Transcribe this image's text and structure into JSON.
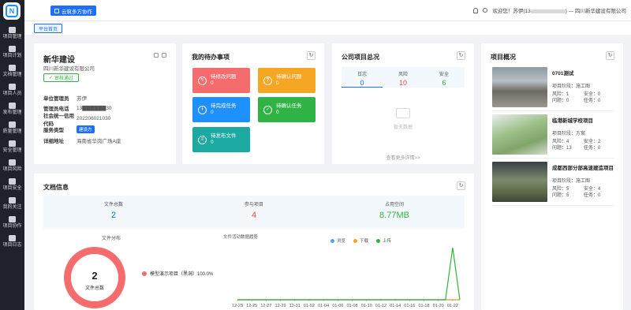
{
  "sidebar": {
    "items": [
      {
        "label": "项目管理",
        "icon": "folder-icon"
      },
      {
        "label": "项目计划",
        "icon": "calendar-icon"
      },
      {
        "label": "文档管理",
        "icon": "document-icon"
      },
      {
        "label": "项目人员",
        "icon": "user-icon"
      },
      {
        "label": "发布管理",
        "icon": "send-icon"
      },
      {
        "label": "质量管理",
        "icon": "check-icon"
      },
      {
        "label": "安全管理",
        "icon": "shield-icon"
      },
      {
        "label": "项目风险",
        "icon": "alert-icon"
      },
      {
        "label": "项目安全",
        "icon": "lock-icon"
      },
      {
        "label": "我的关注",
        "icon": "heart-icon"
      },
      {
        "label": "项目协作",
        "icon": "share-icon"
      },
      {
        "label": "项目日志",
        "icon": "list-icon"
      }
    ]
  },
  "header": {
    "collab_label": "云筑多方协作",
    "welcome": "欢迎您！苏伊(13",
    "company_suffix": ") — 四川新华建设有限公司"
  },
  "tabs": [
    {
      "label": "平台首页"
    }
  ],
  "company": {
    "name": "新华建设",
    "full_name": "四川新华建设有限公司",
    "audit_status": "审核通过",
    "fields": [
      {
        "key": "单位管理员",
        "value": "苏伊"
      },
      {
        "key": "管理员电话",
        "value": "13▇▇▇▇▇▇30"
      },
      {
        "key": "社会统一信用代码",
        "value": "202206021030"
      },
      {
        "key": "服务类型",
        "value": "建设方",
        "tag": true
      },
      {
        "key": "详细地址",
        "value": "海南省华岗广场A座"
      }
    ]
  },
  "todos": {
    "title": "我的待办事项",
    "items": [
      {
        "label": "待修改问题",
        "value": "0",
        "color": "#f56c6c",
        "icon": "edit-icon"
      },
      {
        "label": "待确认问题",
        "value": "0",
        "color": "#f5a623",
        "icon": "question-icon"
      },
      {
        "label": "待完成任务",
        "value": "0",
        "color": "#1e90ff",
        "icon": "info-icon"
      },
      {
        "label": "待确认任务",
        "value": "0",
        "color": "#2fb344",
        "icon": "check-icon"
      },
      {
        "label": "待发布文件",
        "value": "0",
        "color": "#1ba9a1",
        "icon": "file-icon"
      }
    ]
  },
  "overview": {
    "title": "公司项目总况",
    "cols": [
      {
        "label": "日志",
        "value": "0",
        "color": "#1e6fff"
      },
      {
        "label": "风险",
        "value": "10",
        "color": "#f04a4a"
      },
      {
        "label": "安全",
        "value": "6",
        "color": "#2fb344"
      }
    ],
    "empty_text": "暂无数据",
    "more_text": "查看更多详情>>"
  },
  "projects": {
    "title": "项目概况",
    "items": [
      {
        "name": "0701测试",
        "stage": "项目阶段：施工图",
        "risk": "风险：1",
        "safety": "安全：0",
        "issue": "问题：0",
        "task": "任务：0"
      },
      {
        "name": "临港新城学校项目",
        "stage": "项目阶段：方案",
        "risk": "风险：4",
        "safety": "安全：2",
        "issue": "问题：13",
        "task": "任务：0"
      },
      {
        "name": "成都西部分部高速建造项目",
        "stage": "项目阶段：施工图",
        "risk": "风险：5",
        "safety": "安全：4",
        "issue": "问题：5",
        "task": "任务：0"
      }
    ]
  },
  "docs": {
    "title": "文档信息",
    "stats": [
      {
        "label": "文件总数",
        "value": "2",
        "color": "#1e6fff"
      },
      {
        "label": "参与项目",
        "value": "4",
        "color": "#f04a4a"
      },
      {
        "label": "占用空间",
        "value": "8.77MB",
        "color": "#2fb344"
      }
    ],
    "dist_title": "文件分布",
    "donut_value": "2",
    "donut_label": "文件总数",
    "legend_label": "模型演示项目（黑洞）100.0%",
    "trend_title": "文件活动数据趋势"
  },
  "chart_data": {
    "type": "line",
    "title": "文件活动数据趋势",
    "categories": [
      "12-23",
      "12-25",
      "12-27",
      "12-29",
      "12-31",
      "01-02",
      "01-04",
      "01-06",
      "01-08",
      "01-10",
      "01-12",
      "01-14",
      "01-16",
      "01-18",
      "01-20",
      "01-22"
    ],
    "x": [
      "12-23",
      "12-24",
      "12-25",
      "12-26",
      "12-27",
      "12-28",
      "12-29",
      "12-30",
      "12-31",
      "01-01",
      "01-02",
      "01-03",
      "01-04",
      "01-05",
      "01-06",
      "01-07",
      "01-08",
      "01-09",
      "01-10",
      "01-11",
      "01-12",
      "01-13",
      "01-14",
      "01-15",
      "01-16",
      "01-17",
      "01-18",
      "01-19",
      "01-20",
      "01-21",
      "01-22",
      "01-23"
    ],
    "series": [
      {
        "name": "浏览",
        "color": "#4aa3f0",
        "values": [
          0,
          0,
          0,
          0,
          0,
          0,
          0,
          0,
          0,
          0,
          0,
          0,
          0,
          0,
          0,
          0,
          0,
          0,
          0,
          0,
          0,
          0,
          0,
          0,
          0,
          0,
          0,
          0,
          0,
          0,
          0,
          0
        ]
      },
      {
        "name": "下载",
        "color": "#f5a623",
        "values": [
          0,
          0,
          0,
          0,
          0,
          0,
          0,
          0,
          0,
          0,
          0,
          0,
          0,
          0,
          0,
          0,
          0,
          0,
          0,
          0,
          0,
          0,
          0,
          0,
          0,
          0,
          0,
          0,
          0,
          0,
          0,
          0
        ]
      },
      {
        "name": "上传",
        "color": "#2fb344",
        "values": [
          0,
          0,
          0,
          0,
          0,
          0,
          0,
          0,
          0,
          0,
          0,
          0,
          0,
          0,
          0,
          0,
          0,
          0,
          0,
          0,
          0,
          0,
          0,
          0,
          0,
          0,
          0,
          0,
          0,
          0,
          2,
          0
        ]
      }
    ],
    "ylim": [
      0,
      2
    ]
  }
}
